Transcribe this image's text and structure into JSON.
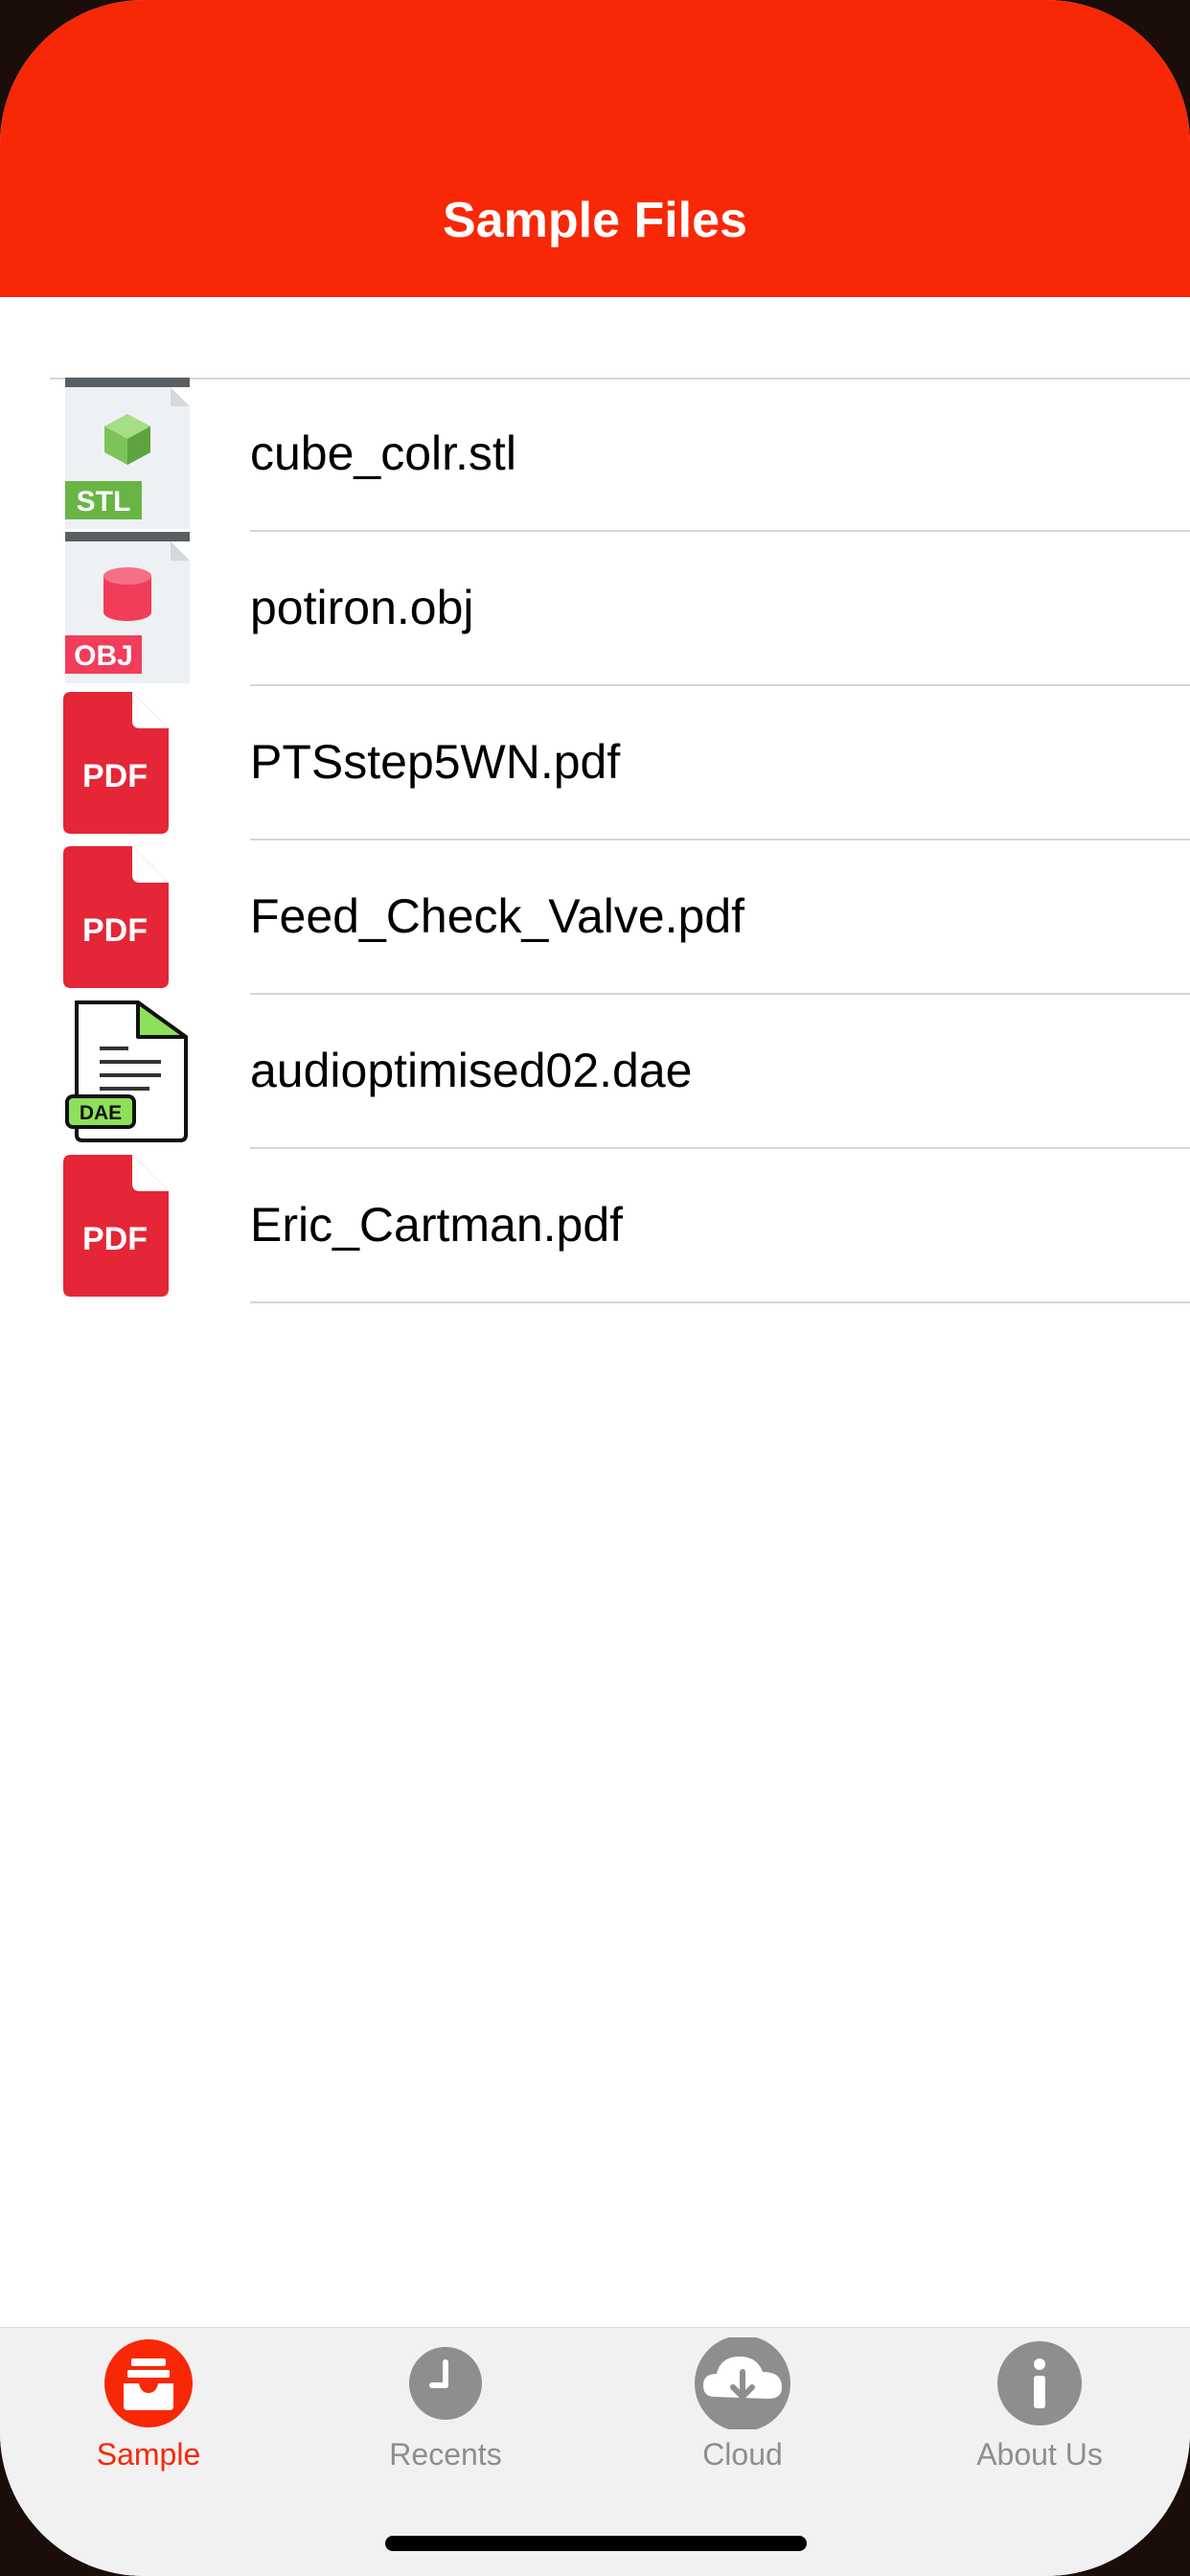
{
  "header": {
    "title": "Sample Files"
  },
  "files": [
    {
      "name": "cube_colr.stl",
      "type": "STL",
      "icon": "stl-file-icon"
    },
    {
      "name": "potiron.obj",
      "type": "OBJ",
      "icon": "obj-file-icon"
    },
    {
      "name": "PTSstep5WN.pdf",
      "type": "PDF",
      "icon": "pdf-file-icon"
    },
    {
      "name": "Feed_Check_Valve.pdf",
      "type": "PDF",
      "icon": "pdf-file-icon"
    },
    {
      "name": "audioptimised02.dae",
      "type": "DAE",
      "icon": "dae-file-icon"
    },
    {
      "name": "Eric_Cartman.pdf",
      "type": "PDF",
      "icon": "pdf-file-icon"
    }
  ],
  "tabs": [
    {
      "label": "Sample",
      "icon": "inbox-icon",
      "selected": true
    },
    {
      "label": "Recents",
      "icon": "clock-icon",
      "selected": false
    },
    {
      "label": "Cloud",
      "icon": "cloud-download-icon",
      "selected": false
    },
    {
      "label": "About Us",
      "icon": "info-icon",
      "selected": false
    }
  ],
  "colors": {
    "accent": "#f82705",
    "tab_inactive": "#8e8e8e",
    "pdf_red": "#e42637",
    "stl_green": "#68b544",
    "obj_pink": "#f23d5a",
    "dae_green": "#8ee05a"
  }
}
